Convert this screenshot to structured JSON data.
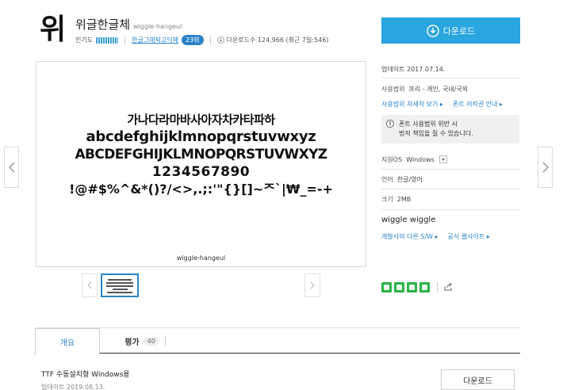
{
  "font": {
    "logo_glyph": "위",
    "name": "위글한글체",
    "name_en": "wiggle-hangeul",
    "popularity_label": "인기도",
    "category_link": "한글그래픽고딕체",
    "rank": "23위",
    "download_count": "다운로드수 124,966 (최근 7일:546)"
  },
  "download_button": {
    "label": "다운로드",
    "icon": "download-circle-icon"
  },
  "preview": {
    "lines": [
      "가나다라마바사아자차카타파하",
      "abcdefghijklmnopqrstuvwxyz",
      "ABCDEFGHIJKLMNOPQRSTUVWXYZ",
      "1234567890",
      "!@#$%^&*()?/<>,.;:'\"{}[]~ᄌ`|₩_=-+"
    ],
    "caption": "wiggle-hangeul"
  },
  "info": {
    "update": "업데이트  2017.07.14.",
    "usage_label": "사용범위",
    "usage_value": "프리 - 개인, 국내/국외",
    "usage_detail_link": "사용범위 자세히 보기",
    "copyright_link": "폰트 저작권 안내",
    "notice_line1": "폰트 사용범위 위반 시",
    "notice_line2": "법적 책임을 질 수 있습니다.",
    "os_label": "지원OS",
    "os_value": "Windows",
    "lang_label": "언어",
    "lang_value": "한글/영어",
    "size_label": "크기",
    "size_value": "2MB",
    "maker": "wiggle wiggle",
    "maker_other_link": "개발사의 다른 S/W",
    "maker_site_link": "공식 웹사이트"
  },
  "license_colors": {
    "green": "#2cb34a"
  },
  "tabs": [
    {
      "label": "개요"
    },
    {
      "label": "평가",
      "count": "40"
    }
  ],
  "file": {
    "title": "TTF 수동설치형 Windows용",
    "date": "업데이트 2019.08.13.",
    "download_label": "다운로드"
  },
  "colors": {
    "accent": "#2aa5e0",
    "link": "#2a83c8"
  }
}
